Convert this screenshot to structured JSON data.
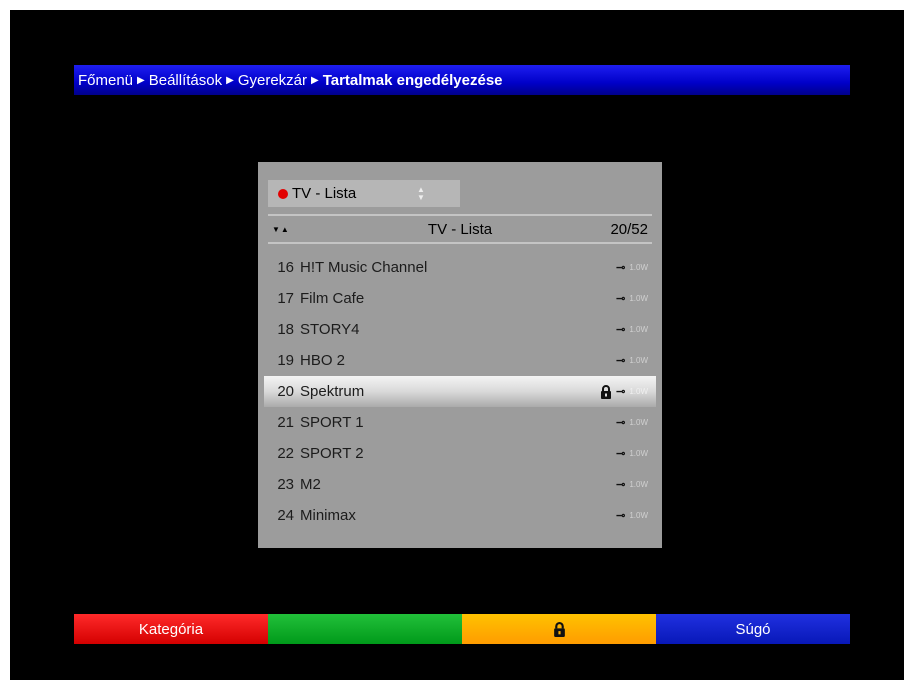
{
  "breadcrumb": {
    "items": [
      "Főmenü",
      "Beállítások",
      "Gyerekzár",
      "Tartalmak engedélyezése"
    ]
  },
  "dropdown": {
    "value": "TV - Lista",
    "indicator_color": "#e20000"
  },
  "list_header": {
    "title": "TV - Lista",
    "count": "20/52"
  },
  "channels": [
    {
      "number": "16",
      "name": "H!T Music Channel",
      "signal": "1.0W",
      "locked": false,
      "selected": false
    },
    {
      "number": "17",
      "name": "Film Cafe",
      "signal": "1.0W",
      "locked": false,
      "selected": false
    },
    {
      "number": "18",
      "name": "STORY4",
      "signal": "1.0W",
      "locked": false,
      "selected": false
    },
    {
      "number": "19",
      "name": "HBO 2",
      "signal": "1.0W",
      "locked": false,
      "selected": false
    },
    {
      "number": "20",
      "name": "Spektrum",
      "signal": "1.0W",
      "locked": true,
      "selected": true
    },
    {
      "number": "21",
      "name": "SPORT 1",
      "signal": "1.0W",
      "locked": false,
      "selected": false
    },
    {
      "number": "22",
      "name": "SPORT 2",
      "signal": "1.0W",
      "locked": false,
      "selected": false
    },
    {
      "number": "23",
      "name": "M2",
      "signal": "1.0W",
      "locked": false,
      "selected": false
    },
    {
      "number": "24",
      "name": "Minimax",
      "signal": "1.0W",
      "locked": false,
      "selected": false
    }
  ],
  "footer": {
    "red_label": "Kategória",
    "green_label": "",
    "yellow_icon": "lock-icon",
    "blue_label": "Súgó"
  },
  "colors": {
    "breadcrumb_bg": "#0000c8",
    "red": "#e20000",
    "green": "#00a020",
    "yellow": "#ffb000",
    "blue": "#0818b8"
  }
}
